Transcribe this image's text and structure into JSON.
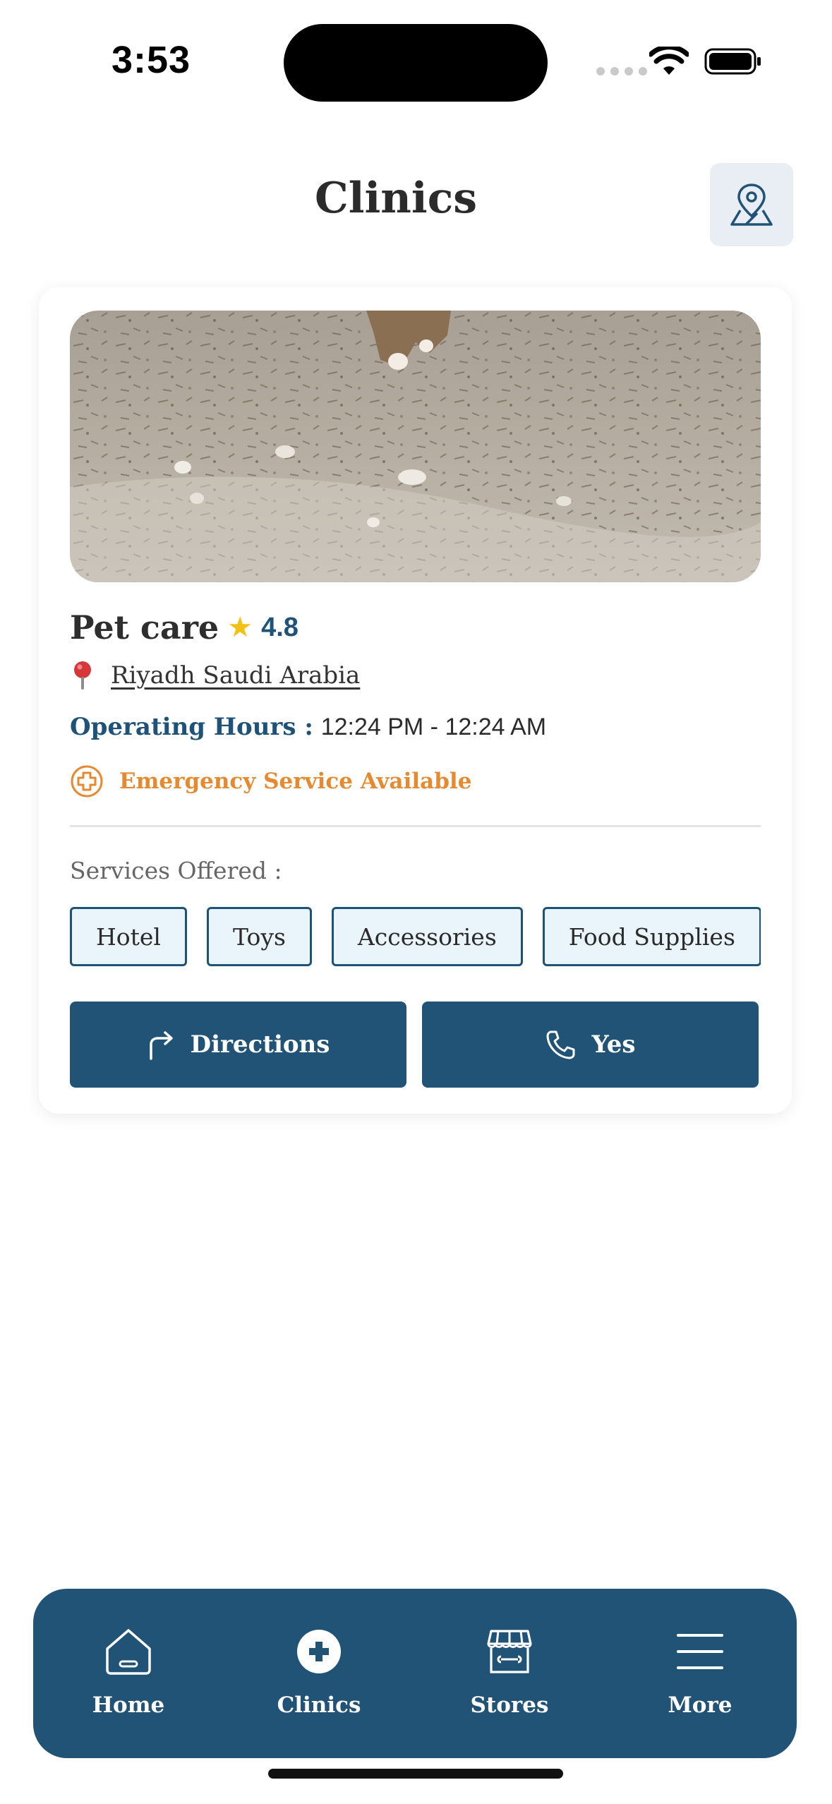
{
  "status_bar": {
    "time": "3:53"
  },
  "header": {
    "title": "Clinics",
    "map_button_icon": "map-pin-icon"
  },
  "clinic": {
    "name": "Pet care",
    "rating": "4.8",
    "location": "Riyadh Saudi Arabia",
    "hours_label": "Operating Hours :",
    "hours_value": "12:24 PM - 12:24 AM",
    "emergency": "Emergency Service Available",
    "services_label": "Services Offered :",
    "services": [
      "Hotel",
      "Toys",
      "Accessories",
      "Food Supplies",
      ""
    ],
    "directions_label": "Directions",
    "call_label": "Yes"
  },
  "nav": {
    "home": "Home",
    "clinics": "Clinics",
    "stores": "Stores",
    "more": "More"
  },
  "colors": {
    "primary": "#215376",
    "accent_orange": "#e58a31",
    "star": "#f3c114",
    "chip_bg": "#eaf4fb"
  }
}
